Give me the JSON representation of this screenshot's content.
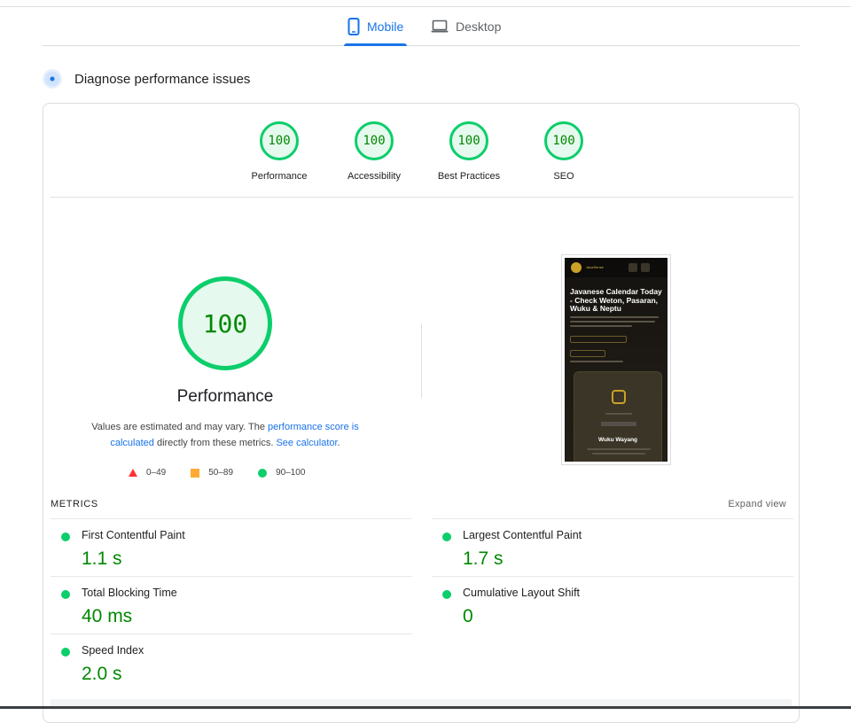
{
  "tabs": [
    {
      "label": "Mobile",
      "icon": "phone-icon",
      "active": true
    },
    {
      "label": "Desktop",
      "icon": "laptop-icon",
      "active": false
    }
  ],
  "diagnose": {
    "title": "Diagnose performance issues",
    "icon": "diagnose-icon"
  },
  "scores": [
    {
      "value": "100",
      "label": "Performance"
    },
    {
      "value": "100",
      "label": "Accessibility"
    },
    {
      "value": "100",
      "label": "Best Practices"
    },
    {
      "value": "100",
      "label": "SEO"
    }
  ],
  "performance": {
    "score": "100",
    "label": "Performance",
    "note_prefix": "Values are estimated and may vary. The ",
    "note_link1": "performance score is calculated",
    "note_middle": " directly from these metrics. ",
    "note_link2": "See calculator",
    "note_suffix": "."
  },
  "legend": [
    {
      "shape": "triangle",
      "color": "#ff3333",
      "label": "0–49"
    },
    {
      "shape": "square",
      "color": "#ffaa33",
      "label": "50–89"
    },
    {
      "shape": "circle",
      "color": "#0cce6b",
      "label": "90–100"
    }
  ],
  "screenshot": {
    "title": "Javanese Calendar Today - Check Weton, Pasaran, Wuku & Neptu",
    "brand": "JavaSense",
    "card_name": "Wuku Wayang"
  },
  "metrics": {
    "title": "METRICS",
    "expand_label": "Expand view",
    "items": [
      {
        "label": "First Contentful Paint",
        "value": "1.1 s"
      },
      {
        "label": "Largest Contentful Paint",
        "value": "1.7 s"
      },
      {
        "label": "Total Blocking Time",
        "value": "40 ms"
      },
      {
        "label": "Cumulative Layout Shift",
        "value": "0"
      },
      {
        "label": "Speed Index",
        "value": "2.0 s"
      }
    ]
  },
  "colors": {
    "accent": "#1a73e8",
    "pass": "#0cce6b",
    "pass_text": "#008800"
  }
}
